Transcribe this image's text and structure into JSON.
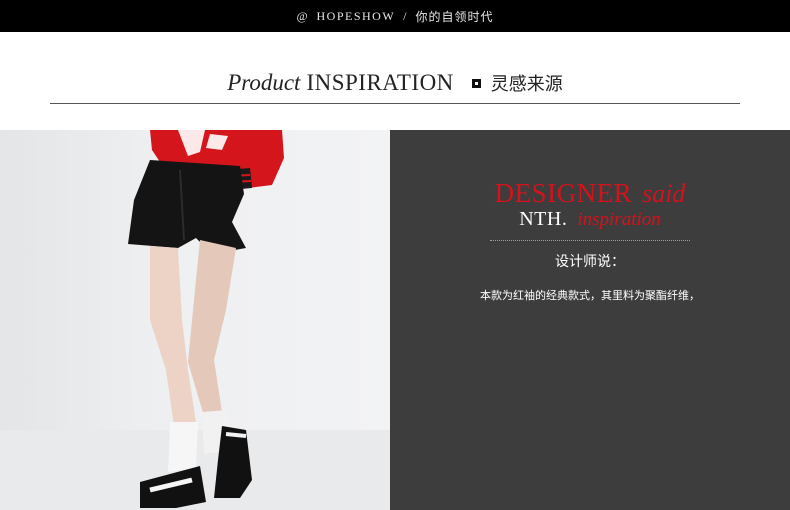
{
  "topbar": {
    "at": "@",
    "brand": "HOPESHOW",
    "separator": "/",
    "tagline": "你的自领时代"
  },
  "heading": {
    "product": "Product",
    "inspiration": "INSPIRATION",
    "chinese": "灵感来源"
  },
  "photo": {
    "alt": "model wearing black shorts, red sweater, white socks and black sandals",
    "colors": {
      "sweater": "#d4151c",
      "shorts": "#141414",
      "socks": "#f5f5f5",
      "sandals": "#111111",
      "skin": "#e8cfc2"
    }
  },
  "designer_panel": {
    "designer": "DESIGNER",
    "said": "said",
    "nth": "NTH.",
    "inspiration": "inspiration",
    "label": "设计师说：",
    "description": "本款为红袖的经典款式，其里料为聚酯纤维，",
    "colors": {
      "background": "#3d3d3d",
      "accent": "#d3121c"
    }
  }
}
